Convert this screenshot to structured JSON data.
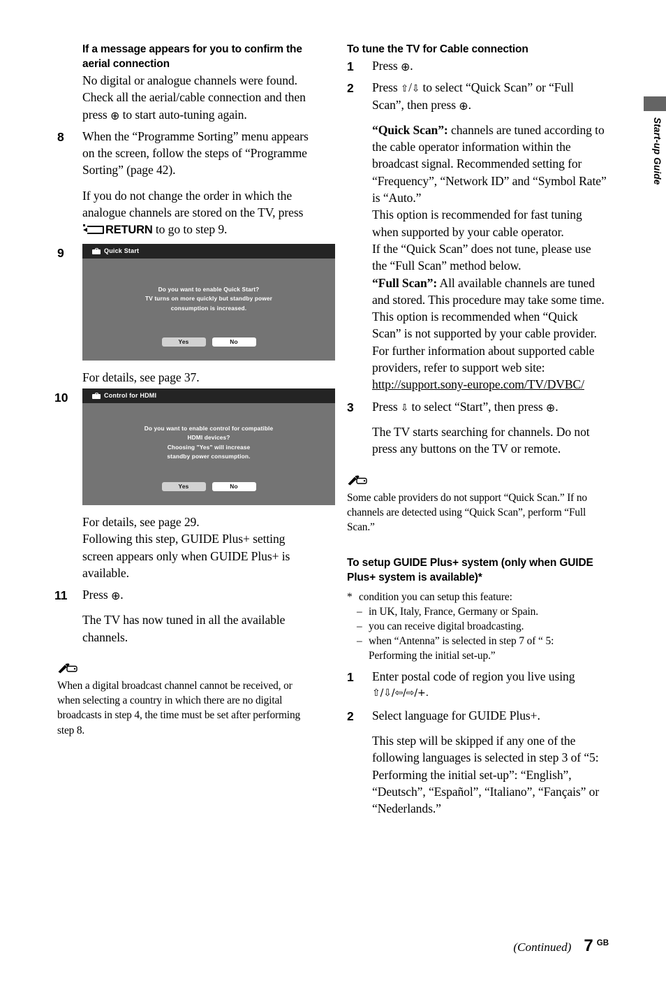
{
  "side_tab": {
    "label": "Start-up Guide",
    "block_color": "#646464"
  },
  "left_column": {
    "heading": "If a message appears for you to confirm the aerial connection",
    "intro_part1": "No digital or analogue channels were found. Check all the aerial/cable connection and then press ",
    "intro_enter_glyph": "⊕",
    "intro_part2": " to start auto-tuning again.",
    "step8": {
      "number": "8",
      "text": "When the “Programme Sorting” menu appears on the screen, follow the steps of “Programme Sorting” (page 42).",
      "note_part1": "If you do not change the order in which the analogue channels are stored on the TV, press ",
      "note_return_label": "RETURN",
      "note_part2": " to go to step 9."
    },
    "step9": {
      "number": "9",
      "screenshot": {
        "title": "Quick Start",
        "title_icon": "toolbox-icon",
        "message_lines": [
          "Do you want to enable Quick Start?",
          "TV turns on more quickly but standby power",
          "consumption is increased."
        ],
        "buttons": [
          {
            "label": "Yes",
            "selected": true
          },
          {
            "label": "No",
            "selected": false
          }
        ]
      },
      "caption": "For details, see page 37."
    },
    "step10": {
      "number": "10",
      "screenshot": {
        "title": "Control for HDMI",
        "title_icon": "toolbox-icon",
        "message_lines": [
          "Do you want to enable control for compatible",
          "HDMI devices?",
          "Choosing \"Yes\" will increase",
          "standby power consumption."
        ],
        "buttons": [
          {
            "label": "Yes",
            "selected": true
          },
          {
            "label": "No",
            "selected": false
          }
        ]
      },
      "caption_line1": "For details, see page 29.",
      "caption_line2": "Following this step, GUIDE Plus+ setting screen appears only when GUIDE Plus+ is available."
    },
    "step11": {
      "number": "11",
      "text_part1": "Press ",
      "enter_glyph": "⊕",
      "text_part2": ".",
      "detail": "The TV has now tuned in all the available channels."
    },
    "note": {
      "icon": "pencil-note-icon",
      "text": "When a digital broadcast channel cannot be received, or when selecting a country in which there are no digital broadcasts in step 4, the time must be set after performing step 8."
    }
  },
  "right_column": {
    "heading": "To tune the TV for Cable connection",
    "step1": {
      "number": "1",
      "text_part1": "Press ",
      "enter_glyph": "⊕",
      "text_part2": "."
    },
    "step2": {
      "number": "2",
      "text_part1": "Press ",
      "up_glyph": "⇧",
      "slash": "/",
      "down_glyph": "⇩",
      "text_part2": " to select “Quick Scan” or “Full Scan”, then press ",
      "enter_glyph": "⊕",
      "text_part3": ".",
      "quick_scan_label": "“Quick Scan”:",
      "quick_scan_text": " channels are tuned according to the cable operator information within the broadcast signal. Recommended setting for “Frequency”, “Network ID” and “Symbol Rate” is “Auto.”",
      "quick_scan_text2": "This option is recommended for fast tuning when supported by your cable operator.",
      "quick_scan_text3": "If the “Quick Scan” does not tune, please use the “Full Scan” method below.",
      "full_scan_label": "“Full Scan”:",
      "full_scan_text": " All available channels are tuned and stored. This procedure may take some time.",
      "full_scan_text2": "This option is recommended when “Quick Scan” is not supported by your cable provider.",
      "full_scan_text3": "For further information about supported cable providers, refer to support web site:",
      "url": "http://support.sony-europe.com/TV/DVBC/"
    },
    "step3": {
      "number": "3",
      "text_part1": "Press ",
      "down_glyph": "⇩",
      "text_part2": " to select “Start”, then press ",
      "enter_glyph": "⊕",
      "text_part3": ".",
      "detail": "The TV starts searching for channels. Do not press any buttons on the TV or remote."
    },
    "note": {
      "icon": "pencil-note-icon",
      "text": "Some cable providers do not support “Quick Scan.” If no channels are detected using “Quick Scan”, perform “Full Scan.”"
    },
    "guide_heading": "To setup GUIDE Plus+ system (only when GUIDE Plus+ system is available)*",
    "footnote": {
      "marker": "*",
      "intro": "condition you can setup this feature:",
      "items": [
        "in UK, Italy, France, Germany or Spain.",
        "you can receive digital broadcasting.",
        "when “Antenna” is selected in step 7 of “ 5:"
      ],
      "item3_cont": "Performing the initial set-up.”",
      "dash": "–"
    },
    "gstep1": {
      "number": "1",
      "text": "Enter postal code of region you live using",
      "glyph_line": "⇧/⇩/⇦/⇨/+."
    },
    "gstep2": {
      "number": "2",
      "text": "Select language for GUIDE Plus+.",
      "detail": "This step will be skipped if any one of the following languages is selected in step 3 of “5: Performing the initial set-up”: “English”, “Deutsch”, “Español”, “Italiano”, “Fançais” or “Nederlands.”"
    }
  },
  "footer": {
    "continued": "(Continued)",
    "page_number": "7",
    "region": "GB"
  }
}
